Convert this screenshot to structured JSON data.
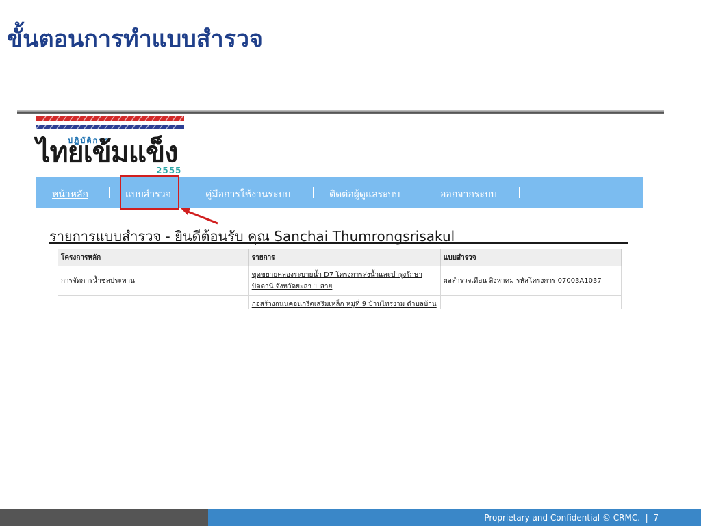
{
  "slide": {
    "title": "ขั้นตอนการทำแบบสำรวจ"
  },
  "logo": {
    "subtitle": "ปฏิบัติการ",
    "wordmark": "ไทยเข้มแข็ง",
    "year": "2555"
  },
  "nav": {
    "items": [
      {
        "label": "หน้าหลัก",
        "underlined": true
      },
      {
        "label": "แบบสำรวจ",
        "underlined": false
      },
      {
        "label": "คู่มือการใช้งานระบบ",
        "underlined": false
      },
      {
        "label": "ติดต่อผู้ดูแลระบบ",
        "underlined": false
      },
      {
        "label": "ออกจากระบบ",
        "underlined": false
      }
    ]
  },
  "list": {
    "heading": "รายการแบบสำรวจ - ยินดีต้อนรับ คุณ Sanchai Thumrongsrisakul"
  },
  "table": {
    "headers": [
      "โครงการหลัก",
      "รายการ",
      "แบบสำรวจ"
    ],
    "rows": [
      {
        "project": "การจัดการน้ำชลประทาน",
        "item": "ขุดขยายคลองระบายน้ำ D7 โครงการส่งน้ำและบำรุงรักษาปัตตานี จังหวัดยะลา 1 สาย",
        "survey": "ผลสำรวจเดือน สิงหาคม รหัสโครงการ 07003A1037"
      },
      {
        "project": "",
        "item": "ก่อสร้างถนนคอนกรีตเสริมเหล็ก หมู่ที่ 9 บ้านไทรงาม ตำบลบ้าน",
        "survey": ""
      }
    ]
  },
  "footer": {
    "text": "Proprietary and Confidential © CRMC.",
    "separator": "|",
    "page": "7"
  },
  "colors": {
    "title": "#1f3f8a",
    "nav_bg": "#7bbcf0",
    "highlight": "#d11f1f",
    "footer_blue": "#3a87c8",
    "footer_gray": "#555555"
  }
}
